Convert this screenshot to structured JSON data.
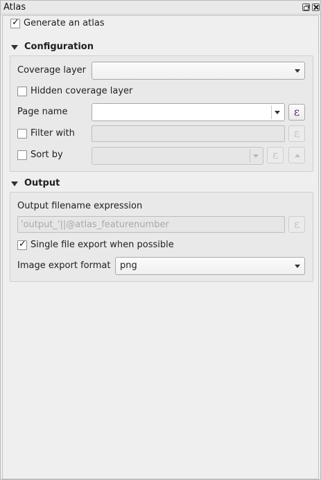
{
  "window": {
    "title": "Atlas"
  },
  "generate": {
    "label": "Generate an atlas",
    "checked": true
  },
  "configuration": {
    "title": "Configuration",
    "coverage_layer_label": "Coverage layer",
    "coverage_layer_value": "",
    "hidden_coverage_label": "Hidden coverage layer",
    "page_name_label": "Page name",
    "page_name_value": "",
    "filter_with_label": "Filter with",
    "sort_by_label": "Sort by"
  },
  "output": {
    "title": "Output",
    "filename_label": "Output filename expression",
    "filename_value": "'output_'||@atlas_featurenumber",
    "single_file_label": "Single file export when possible",
    "single_file_checked": true,
    "image_format_label": "Image export format",
    "image_format_value": "png"
  },
  "icons": {
    "expression": "ε"
  }
}
